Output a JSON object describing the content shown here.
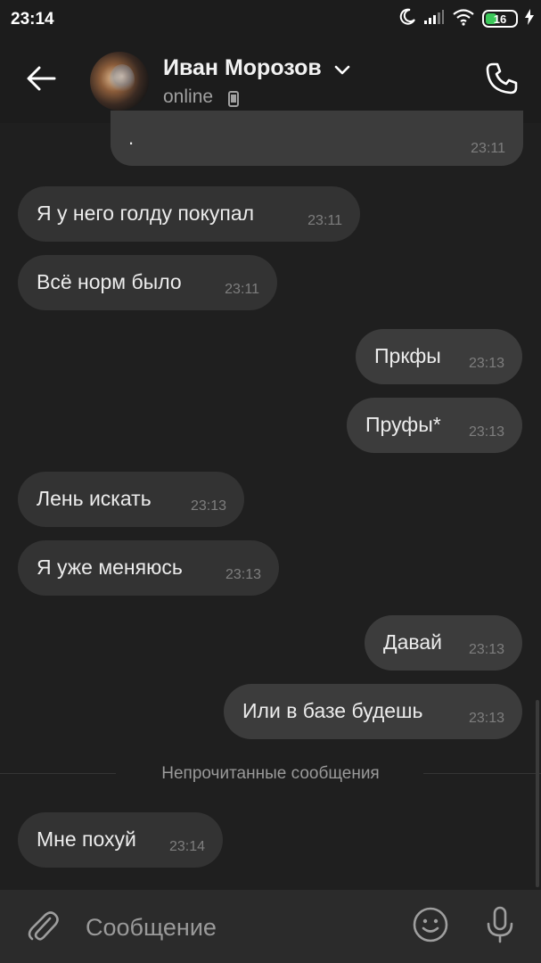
{
  "status_bar": {
    "time": "23:14",
    "battery": "16",
    "icons": [
      "moon-icon",
      "signal-icon",
      "wifi-icon",
      "battery-icon",
      "charging-icon"
    ]
  },
  "header": {
    "contact_name": "Иван Морозов",
    "status": "online",
    "icons": [
      "back-arrow-icon",
      "chevron-down-icon",
      "phone-device-icon",
      "phone-call-icon"
    ]
  },
  "messages": [
    {
      "dir": "out",
      "text": ".",
      "time": "23:11"
    },
    {
      "dir": "in",
      "text": "Я у него голду покупал",
      "time": "23:11"
    },
    {
      "dir": "in",
      "text": "Всё норм было",
      "time": "23:11"
    },
    {
      "dir": "out",
      "text": "Пркфы",
      "time": "23:13"
    },
    {
      "dir": "out",
      "text": "Пруфы*",
      "time": "23:13"
    },
    {
      "dir": "in",
      "text": "Лень искать",
      "time": "23:13"
    },
    {
      "dir": "in",
      "text": "Я уже меняюсь",
      "time": "23:13"
    },
    {
      "dir": "out",
      "text": "Давай",
      "time": "23:13"
    },
    {
      "dir": "out",
      "text": "Или в базе будешь",
      "time": "23:13"
    },
    {
      "dir": "in",
      "text": "Мне похуй",
      "time": "23:14"
    }
  ],
  "unread_divider": "Непрочитанные сообщения",
  "composer": {
    "placeholder": "Сообщение",
    "icons": [
      "paperclip-icon",
      "emoji-icon",
      "microphone-icon"
    ]
  },
  "colors": {
    "background": "#1f1f1f",
    "incoming_bubble": "#333333",
    "outgoing_bubble": "#3c3c3c",
    "composer": "#2b2b2b",
    "battery_fill": "#3cc85a"
  }
}
